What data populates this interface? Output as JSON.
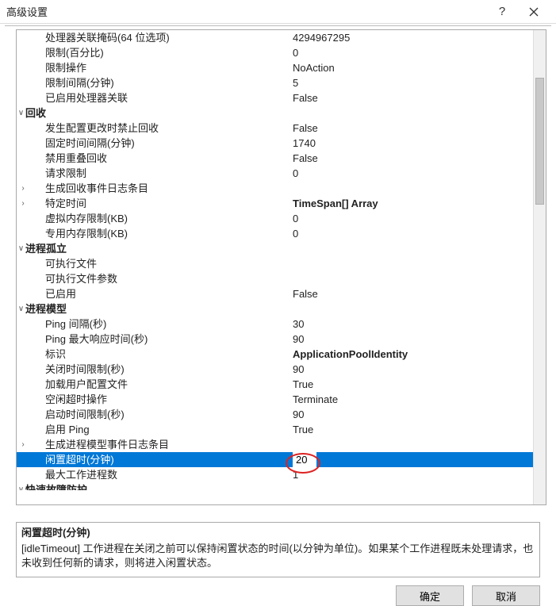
{
  "window": {
    "title": "高级设置",
    "help": "?"
  },
  "rows": [
    {
      "type": "item",
      "label": "处理器关联掩码(64 位选项)",
      "value": "4294967295"
    },
    {
      "type": "item",
      "label": "限制(百分比)",
      "value": "0"
    },
    {
      "type": "item",
      "label": "限制操作",
      "value": "NoAction"
    },
    {
      "type": "item",
      "label": "限制间隔(分钟)",
      "value": "5"
    },
    {
      "type": "item",
      "label": "已启用处理器关联",
      "value": "False"
    },
    {
      "type": "cat",
      "caret": "open",
      "label": "回收"
    },
    {
      "type": "item",
      "label": "发生配置更改时禁止回收",
      "value": "False"
    },
    {
      "type": "item",
      "label": "固定时间间隔(分钟)",
      "value": "1740"
    },
    {
      "type": "item",
      "label": "禁用重叠回收",
      "value": "False"
    },
    {
      "type": "item",
      "label": "请求限制",
      "value": "0"
    },
    {
      "type": "sub",
      "caret": "closed",
      "label": "生成回收事件日志条目"
    },
    {
      "type": "sub",
      "caret": "closed",
      "label": "特定时间",
      "value": "TimeSpan[] Array",
      "bold": true
    },
    {
      "type": "item",
      "label": "虚拟内存限制(KB)",
      "value": "0"
    },
    {
      "type": "item",
      "label": "专用内存限制(KB)",
      "value": "0"
    },
    {
      "type": "cat",
      "caret": "open",
      "label": "进程孤立"
    },
    {
      "type": "item",
      "label": "可执行文件",
      "value": ""
    },
    {
      "type": "item",
      "label": "可执行文件参数",
      "value": ""
    },
    {
      "type": "item",
      "label": "已启用",
      "value": "False"
    },
    {
      "type": "cat",
      "caret": "open",
      "label": "进程模型"
    },
    {
      "type": "item",
      "label": "Ping 间隔(秒)",
      "value": "30"
    },
    {
      "type": "item",
      "label": "Ping 最大响应时间(秒)",
      "value": "90"
    },
    {
      "type": "item",
      "label": "标识",
      "value": "ApplicationPoolIdentity",
      "bold": true
    },
    {
      "type": "item",
      "label": "关闭时间限制(秒)",
      "value": "90"
    },
    {
      "type": "item",
      "label": "加载用户配置文件",
      "value": "True"
    },
    {
      "type": "item",
      "label": "空闲超时操作",
      "value": "Terminate"
    },
    {
      "type": "item",
      "label": "启动时间限制(秒)",
      "value": "90"
    },
    {
      "type": "item",
      "label": "启用 Ping",
      "value": "True"
    },
    {
      "type": "sub",
      "caret": "closed",
      "label": "生成进程模型事件日志条目"
    },
    {
      "type": "item",
      "selected": true,
      "label": "闲置超时(分钟)",
      "value": "20"
    },
    {
      "type": "item",
      "label": "最大工作进程数",
      "value": "1"
    },
    {
      "type": "cat",
      "caret": "open",
      "label": "快速故障防护",
      "cut": true
    }
  ],
  "desc": {
    "title": "闲置超时(分钟)",
    "body": "[idleTimeout] 工作进程在关闭之前可以保持闲置状态的时间(以分钟为单位)。如果某个工作进程既未处理请求，也未收到任何新的请求，则将进入闲置状态。"
  },
  "buttons": {
    "ok": "确定",
    "cancel": "取消"
  },
  "carets": {
    "open": "∨",
    "closed": "›"
  }
}
